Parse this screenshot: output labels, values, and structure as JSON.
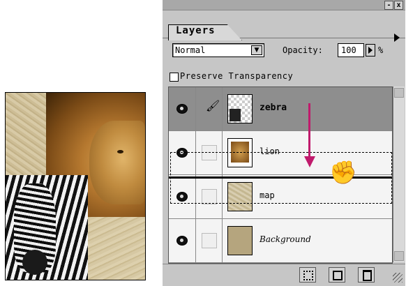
{
  "palette": {
    "tab_label": "Layers",
    "window_buttons": {
      "minimize": "-",
      "close": "x"
    },
    "blend_mode": {
      "value": "Normal"
    },
    "opacity": {
      "label": "Opacity:",
      "value": "100",
      "unit": "%"
    },
    "preserve_transparency": {
      "label": "Preserve Transparency",
      "checked": false
    },
    "layers": [
      {
        "name": "zebra",
        "selected": true,
        "visible": true,
        "paint_icon": "paintbrush-icon"
      },
      {
        "name": "lion",
        "selected": false,
        "visible": true
      },
      {
        "name": "map",
        "selected": false,
        "visible": true
      },
      {
        "name": "Background",
        "selected": false,
        "visible": true
      }
    ],
    "footer_icons": [
      "layer-mask-icon",
      "new-layer-icon",
      "trash-icon"
    ]
  },
  "colors": {
    "drag_arrow": "#c01a6c",
    "selected_row": "#8e8e8e",
    "panel": "#c6c6c6"
  }
}
